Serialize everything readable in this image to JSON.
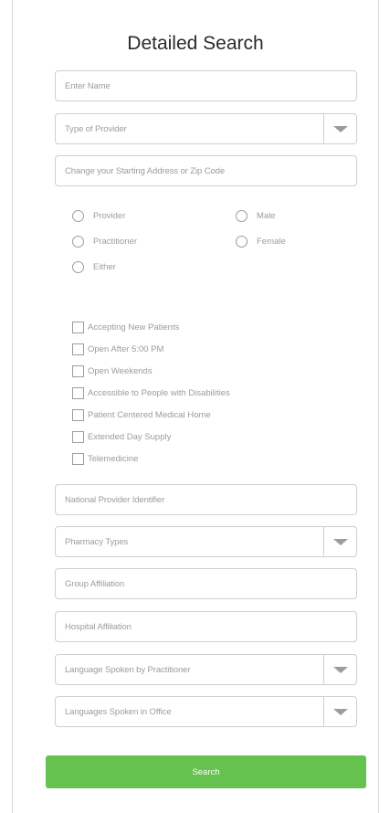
{
  "title": "Detailed Search",
  "fields": {
    "name": "Enter Name",
    "provider_type": "Type of Provider",
    "address": "Change your Starting Address or Zip Code",
    "npi": "National Provider Identifier",
    "pharmacy": "Pharmacy Types",
    "group": "Group Affiliation",
    "hospital": "Hospital Affiliation",
    "lang_practitioner": "Language Spoken by Practitioner",
    "lang_office": "Languages Spoken in Office"
  },
  "radios": {
    "provider": "Provider",
    "practitioner": "Practitioner",
    "either": "Either",
    "male": "Male",
    "female": "Female"
  },
  "checkboxes": [
    "Accepting New Patients",
    "Open After 5:00 PM",
    "Open Weekends",
    "Accessible to People with Disabilities",
    "Patient Centered Medical Home",
    "Extended Day Supply",
    "Telemedicine"
  ],
  "search_label": "Search",
  "colors": {
    "accent": "#66c24f",
    "border": "#cfcfcf",
    "placeholder": "#9c9c9c"
  },
  "icons": {
    "dropdown": "triangle-down-icon",
    "radio": "radio-empty-icon",
    "checkbox": "checkbox-empty-icon"
  }
}
